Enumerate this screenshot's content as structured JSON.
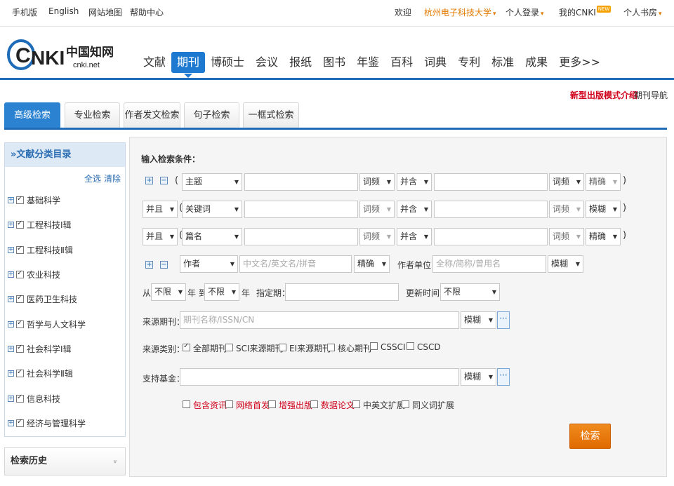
{
  "topbar": {
    "mobile": "手机版",
    "english": "English",
    "sitemap": "网站地图",
    "help": "帮助中心",
    "welcome": "欢迎",
    "university": "杭州电子科技大学",
    "login": "个人登录",
    "mycnki": "我的CNKI",
    "new_badge": "NEW",
    "study": "个人书房"
  },
  "logo": {
    "cn": "中国知网",
    "domain": "cnki.net"
  },
  "nav": {
    "items": [
      "文献",
      "期刊",
      "博硕士",
      "会议",
      "报纸",
      "图书",
      "年鉴",
      "百科",
      "词典",
      "专利",
      "标准",
      "成果",
      "更多>>"
    ]
  },
  "promo": {
    "new_model": "新型出版模式介绍",
    "journal_nav": "期刊导航"
  },
  "tabs": [
    "高级检索",
    "专业检索",
    "作者发文检索",
    "句子检索",
    "一框式检索"
  ],
  "sidebar": {
    "title": "»文献分类目录",
    "select_all": "全选",
    "clear": "清除",
    "items": [
      "基础科学",
      "工程科技Ⅰ辑",
      "工程科技Ⅱ辑",
      "农业科技",
      "医药卫生科技",
      "哲学与人文科学",
      "社会科学Ⅰ辑",
      "社会科学Ⅱ辑",
      "信息科技",
      "经济与管理科学"
    ]
  },
  "history": {
    "title": "检索历史",
    "chevron": "»"
  },
  "form": {
    "heading": "输入检索条件：",
    "rows": [
      {
        "logic": "",
        "field": "主题",
        "freq1": "词频",
        "op": "并含",
        "freq2": "词频",
        "match": "精确"
      },
      {
        "logic": "并且",
        "field": "关键词",
        "freq1": "词频",
        "op": "并含",
        "freq2": "词频",
        "match": "模糊"
      },
      {
        "logic": "并且",
        "field": "篇名",
        "freq1": "词频",
        "op": "并含",
        "freq2": "词频",
        "match": "精确"
      }
    ],
    "author": {
      "type": "作者",
      "placeholder": "中文名/英文名/拼音",
      "match": "精确",
      "org_label": "作者单位：",
      "org_placeholder": "全称/简称/曾用名",
      "org_match": "模糊"
    },
    "date": {
      "from": "从",
      "from_value": "不限",
      "year_to": "年 到",
      "to_value": "不限",
      "year": "年",
      "specified": "指定期：",
      "update_label": "更新时间：",
      "update_value": "不限"
    },
    "source": {
      "label": "来源期刊：",
      "placeholder": "期刊名称/ISSN/CN",
      "match": "模糊"
    },
    "category": {
      "label": "来源类别：",
      "options": [
        "全部期刊",
        "SCI来源期刊",
        "EI来源期刊",
        "核心期刊",
        "CSSCI",
        "CSCD"
      ]
    },
    "fund": {
      "label": "支持基金：",
      "match": "模糊"
    },
    "extras": [
      "包含资讯",
      "网络首发",
      "增强出版",
      "数据论文",
      "中英文扩展",
      "同义词扩展"
    ],
    "search_button": "检索"
  },
  "colors": {
    "primary": "#1e6bb8",
    "accent_orange": "#e27a00",
    "red": "#d0021b"
  }
}
